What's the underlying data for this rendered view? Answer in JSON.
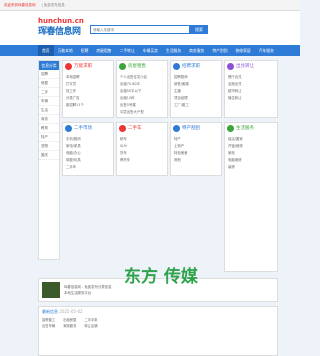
{
  "topbar": {
    "left": "欢迎来到珲春信息网",
    "right": "| 免费发布信息"
  },
  "logo": {
    "url": "hunchun.cn",
    "name": "珲春信息网"
  },
  "search": {
    "placeholder": "请输入关键词",
    "button": "搜索"
  },
  "nav": [
    "首页",
    "万能本地",
    "招聘",
    "房屋租售",
    "二手转让",
    "车辆买卖",
    "生活服务",
    "商务服务",
    "特产刮刮",
    "装修家居",
    "汽车服务",
    "婚庆",
    "论坛"
  ],
  "sidebar": {
    "head": "信息分类",
    "items": [
      "招聘",
      "房屋",
      "二手",
      "车辆",
      "生活",
      "商务",
      "教育",
      "特产",
      "宠物",
      "婚庆"
    ]
  },
  "panels": {
    "p1": {
      "title": "万能求职",
      "lines": [
        "本地招聘",
        "打字员",
        "找工作",
        "分类广告",
        "新招聘11个"
      ]
    },
    "p2": {
      "title": "房屋租售",
      "lines": [
        "个人出售住宅小区",
        "出租70-80平",
        "出租50平以下",
        "出租12栋",
        "出售5号楼",
        "平层出售大户型",
        "新房出售"
      ]
    },
    "p3": {
      "title": "招聘求职",
      "lines": [
        "招聘厨师",
        "销售/客服",
        "主播",
        "项目经理",
        "工厂/普工"
      ]
    },
    "p4": {
      "title": "出兑转让",
      "lines": [
        "餐厅出兑",
        "店面出兑",
        "超市转让",
        "摊位转让"
      ]
    },
    "p5": {
      "title": "二手市场",
      "lines": [
        "手机/数码",
        "家电/家具",
        "电脑/办公",
        "母婴/玩具",
        "二手车",
        "本地二手"
      ]
    },
    "p6": {
      "title": "二手车",
      "lines": [
        "轿车",
        "SUV",
        "货车",
        "摩托车"
      ]
    },
    "p7": {
      "title": "生活服务",
      "lines": [
        "保洁/搬家",
        "开锁/维修",
        "家政",
        "电脑维修",
        "装修"
      ]
    },
    "p8": {
      "title": "特产刮刮",
      "lines": [
        "特产",
        "土特产",
        "特色美食",
        "其他"
      ]
    }
  },
  "banner": {
    "l1": "珲春信息网 - 免费发布分类信息",
    "l2": "本地生活服务平台"
  },
  "latest": {
    "head": "最新信息",
    "date": "2025-05-02",
    "rows": [
      [
        "招聘普工",
        "出租房屋",
        "二手手机"
      ],
      [
        "出售车辆",
        "家政服务",
        "转让店铺"
      ]
    ]
  },
  "watermark": "东方 传媒"
}
